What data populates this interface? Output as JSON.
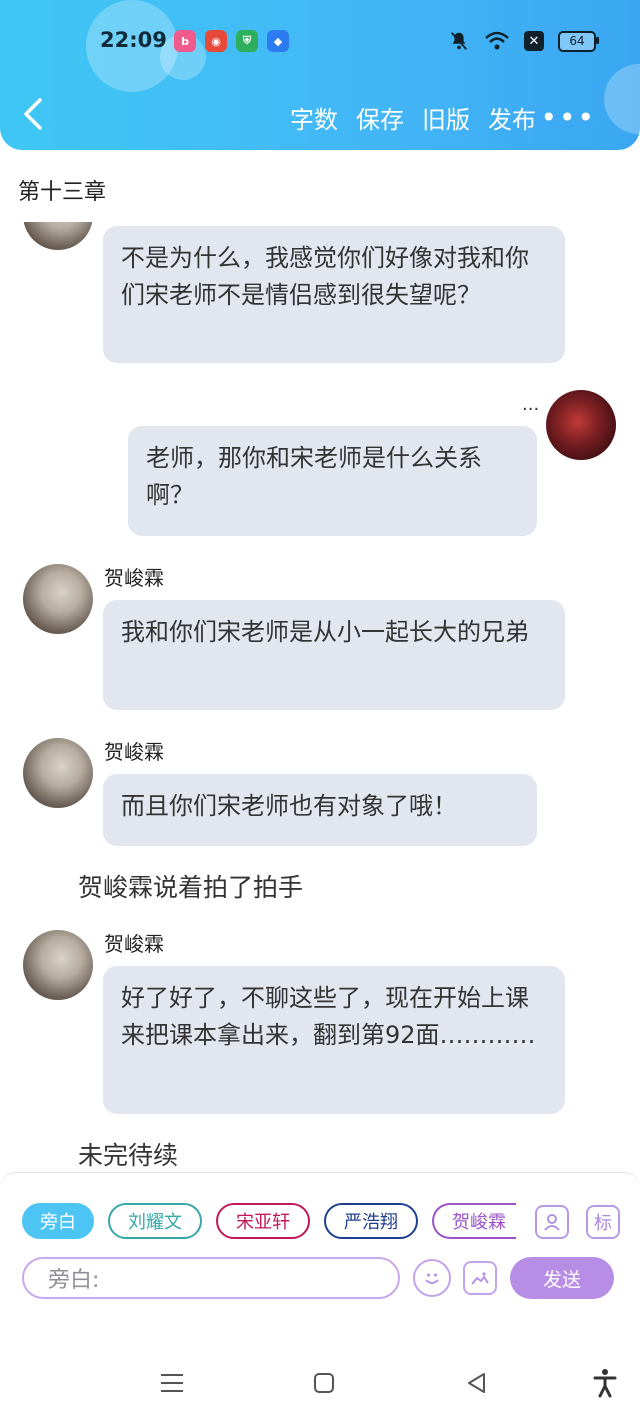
{
  "status_bar": {
    "time": "22:09",
    "battery": "64"
  },
  "header": {
    "actions": [
      "字数",
      "保存",
      "旧版",
      "发布"
    ],
    "more": "•••"
  },
  "chapter": {
    "title": "第十三章"
  },
  "chat": {
    "msg1": {
      "text": "不是为什么，我感觉你们好像对我和你们宋老师不是情侣感到很失望呢？"
    },
    "msg2": {
      "speaker": "...",
      "text": "老师，那你和宋老师是什么关系啊？"
    },
    "msg3": {
      "speaker": "贺峻霖",
      "text": "我和你们宋老师是从小一起长大的兄弟"
    },
    "msg4": {
      "speaker": "贺峻霖",
      "text": "而且你们宋老师也有对象了哦！"
    },
    "narration1": "贺峻霖说着拍了拍手",
    "msg5": {
      "speaker": "贺峻霖",
      "text": "好了好了，不聊这些了，现在开始上课来把课本拿出来，翻到第92面…………"
    },
    "narration2": "未完待续"
  },
  "composer": {
    "roles": [
      "旁白",
      "刘耀文",
      "宋亚轩",
      "严浩翔",
      "贺峻霖"
    ],
    "mark_label": "标",
    "input_placeholder": "旁白:",
    "send_label": "发送"
  },
  "colors": {
    "header": "#43b6f6",
    "accent_blue": "#4cc5f5",
    "accent_purple": "#b88de6",
    "bubble": "#e2e6ef",
    "chip_liuyaowen": "#35a7a8",
    "chip_songyaxuan": "#c2185b",
    "chip_yanhaoxiang": "#1f3f8f",
    "chip_hejunlin": "#9c53c9"
  }
}
